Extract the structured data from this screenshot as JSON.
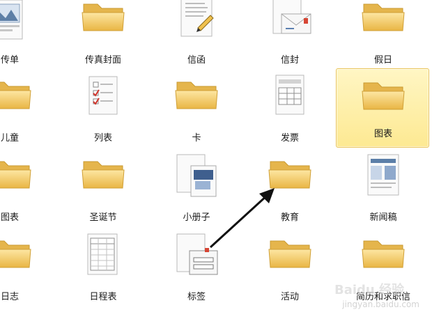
{
  "templates": [
    {
      "label": "传单",
      "icon": "flyer-doc-icon"
    },
    {
      "label": "传真封面",
      "icon": "folder-icon"
    },
    {
      "label": "信函",
      "icon": "letter-doc-icon"
    },
    {
      "label": "信封",
      "icon": "envelope-doc-icon"
    },
    {
      "label": "假日",
      "icon": "folder-icon"
    },
    {
      "label": "儿童",
      "icon": "folder-icon"
    },
    {
      "label": "列表",
      "icon": "checklist-doc-icon"
    },
    {
      "label": "卡",
      "icon": "folder-icon"
    },
    {
      "label": "发票",
      "icon": "invoice-doc-icon"
    },
    {
      "label": "图表",
      "icon": "folder-icon",
      "selected": true
    },
    {
      "label": "图表",
      "icon": "folder-icon"
    },
    {
      "label": "圣诞节",
      "icon": "folder-icon"
    },
    {
      "label": "小册子",
      "icon": "brochure-doc-icon"
    },
    {
      "label": "教育",
      "icon": "folder-icon"
    },
    {
      "label": "新闻稿",
      "icon": "newsletter-doc-icon"
    },
    {
      "label": "日志",
      "icon": "folder-icon"
    },
    {
      "label": "日程表",
      "icon": "schedule-doc-icon"
    },
    {
      "label": "标签",
      "icon": "labels-doc-icon"
    },
    {
      "label": "活动",
      "icon": "folder-icon"
    },
    {
      "label": "简历和求职信",
      "icon": "folder-icon"
    }
  ],
  "colors": {
    "folder": "#f4c95a",
    "selected_bg": "#fde992",
    "arrow": "#111111"
  },
  "watermark": {
    "logo": "Baidu 经验",
    "url": "jingyan.baidu.com"
  }
}
